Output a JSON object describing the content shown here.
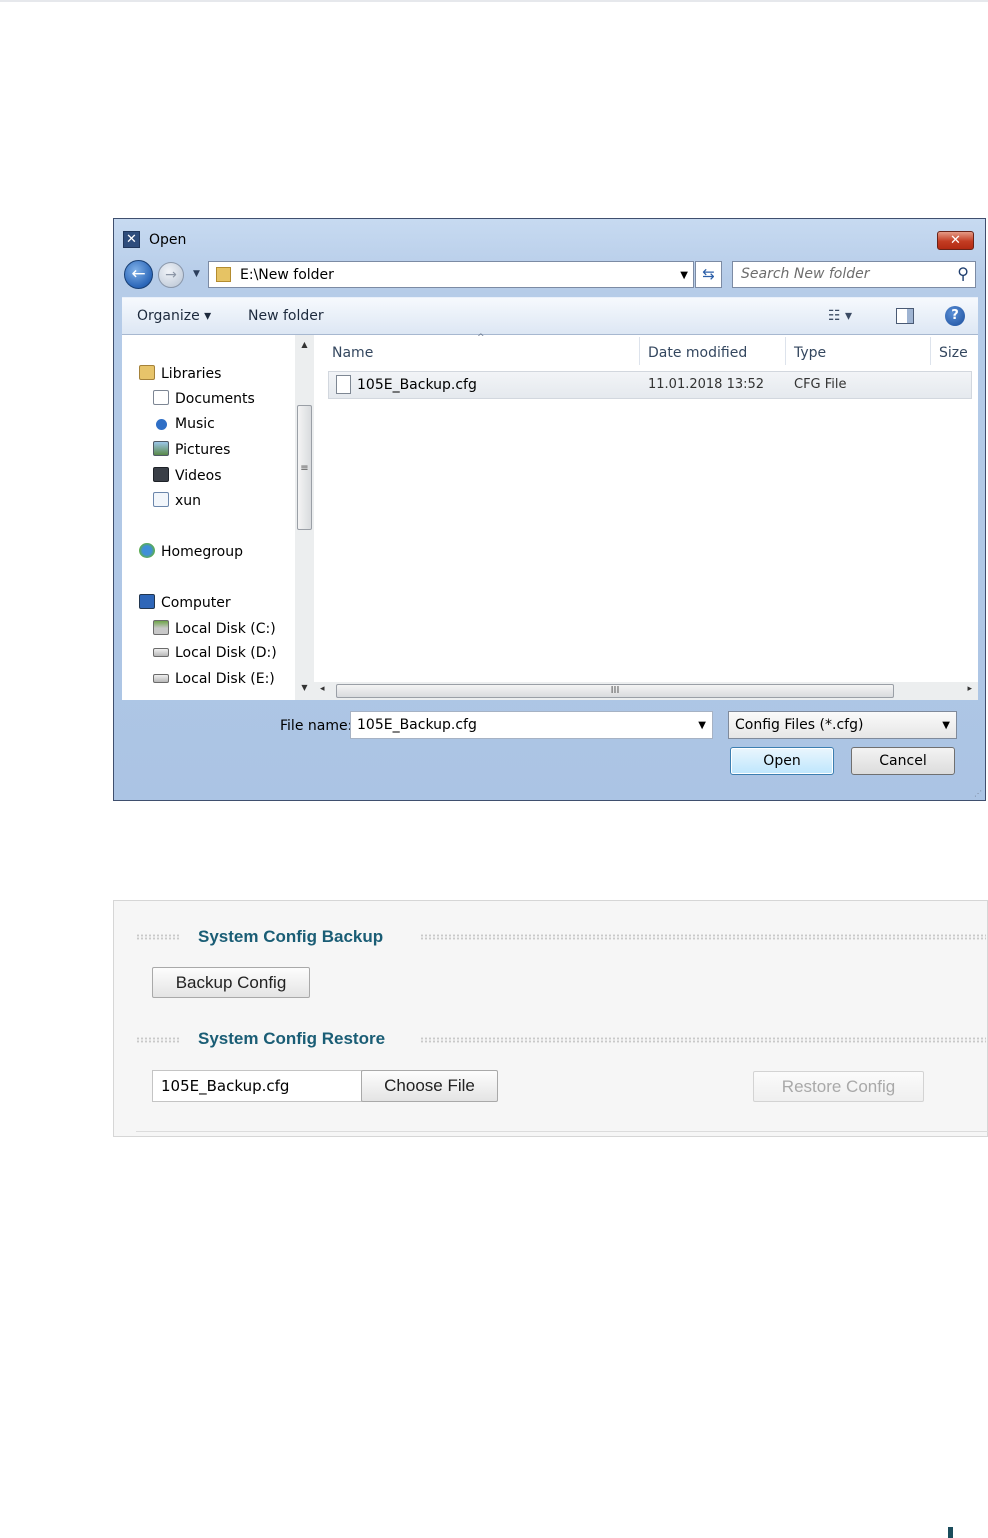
{
  "dialog": {
    "title": "Open",
    "address_path": "E:\\New folder",
    "search_placeholder": "Search New folder",
    "toolbar": {
      "organize": "Organize ▾",
      "new_folder": "New folder"
    },
    "nav_pane": [
      {
        "label": "Libraries",
        "icon": "libraries-icon"
      },
      {
        "label": "Documents",
        "icon": "documents-icon"
      },
      {
        "label": "Music",
        "icon": "music-icon"
      },
      {
        "label": "Pictures",
        "icon": "pictures-icon"
      },
      {
        "label": "Videos",
        "icon": "videos-icon"
      },
      {
        "label": "xun",
        "icon": "user-folder-icon"
      },
      {
        "label": "Homegroup",
        "icon": "homegroup-icon"
      },
      {
        "label": "Computer",
        "icon": "computer-icon"
      },
      {
        "label": "Local Disk (C:)",
        "icon": "system-drive-icon"
      },
      {
        "label": "Local Disk (D:)",
        "icon": "drive-icon"
      },
      {
        "label": "Local Disk (E:)",
        "icon": "drive-icon"
      }
    ],
    "columns": {
      "name": "Name",
      "date": "Date modified",
      "type": "Type",
      "size": "Size"
    },
    "files": [
      {
        "name": "105E_Backup.cfg",
        "date": "11.01.2018 13:52",
        "type": "CFG File"
      }
    ],
    "file_name_label": "File name:",
    "file_name_value": "105E_Backup.cfg",
    "file_type_filter": "Config Files (*.cfg)",
    "open_label": "Open",
    "cancel_label": "Cancel"
  },
  "panel": {
    "backup_title": "System Config Backup",
    "backup_button": "Backup Config",
    "restore_title": "System Config Restore",
    "selected_file": "105E_Backup.cfg",
    "choose_file_button": "Choose File",
    "restore_button": "Restore Config"
  },
  "colors": {
    "section_title": "#1a5d75",
    "dialog_frame": "#abc4e4",
    "close_button": "#c33c22"
  }
}
